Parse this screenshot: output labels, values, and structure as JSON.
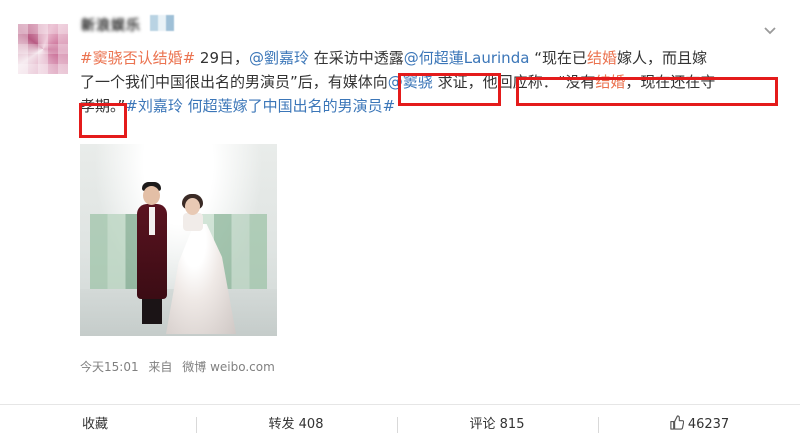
{
  "user": {
    "name": "新浪娱乐"
  },
  "post": {
    "line1": {
      "hashtag1": "#窦骁否认结婚#",
      "t1": " 29日，",
      "mention1": "@劉嘉玲",
      "t2": " 在采访中透露",
      "mention2": "@何超蓮Laurinda",
      "t3": " “现在已",
      "kw1": "结婚",
      "t4": "嫁人，而且嫁"
    },
    "line2": {
      "t1": "了一个我们中国很出名的男演员”后，有媒体向",
      "mention": "@窦骁",
      "t2": " 求证，他回应称：“没有",
      "kw": "结婚",
      "t3": "，现在还在守"
    },
    "line3": {
      "t1": "孝期。”",
      "hashtag1": "#刘嘉玲 何超莲嫁了中国出名的男演员#"
    }
  },
  "meta": {
    "time": "今天15:01",
    "from_label": "来自",
    "source": "微博 weibo.com"
  },
  "actions": {
    "collect": "收藏",
    "repost": "转发 408",
    "comment": "评论 815",
    "like": "46237"
  },
  "colors": {
    "link_orange": "#eb7350",
    "link_blue": "#3b76b8",
    "highlight_red": "#e41b1b"
  }
}
